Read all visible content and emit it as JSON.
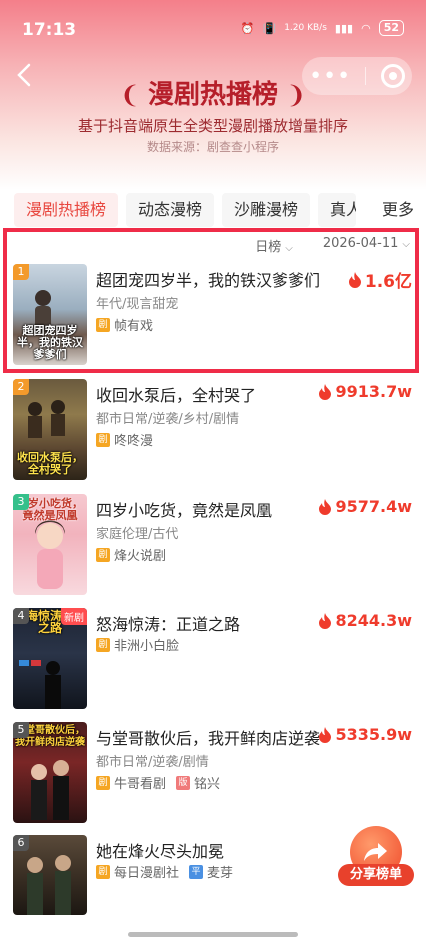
{
  "status": {
    "time": "17:13",
    "network": "1.20 KB/s",
    "signal": "5G",
    "battery": "52"
  },
  "header": {
    "title": "漫剧热播榜",
    "subtitle": "基于抖音端原生全类型漫剧播放增量排序",
    "source": "数据来源：剧查查小程序"
  },
  "tabs": [
    {
      "label": "漫剧热播榜",
      "active": true
    },
    {
      "label": "动态漫榜"
    },
    {
      "label": "沙雕漫榜"
    },
    {
      "label": "真人"
    }
  ],
  "more_label": "更多",
  "filter": {
    "period": "日榜",
    "date": "2026-04-11"
  },
  "items": [
    {
      "rank": "1",
      "rank_color": "#f39a2b",
      "title": "超团宠四岁半，我的铁汉爹爹们",
      "genre": "年代/现言甜宠",
      "tag1": "帧有戏",
      "heat": "1.6亿",
      "poster_text": "超团宠四岁半，我的铁汉爹爹们"
    },
    {
      "rank": "2",
      "rank_color": "#f39a2b",
      "title": "收回水泵后，全村哭了",
      "genre": "都市日常/逆袭/乡村/剧情",
      "tag1": "咚咚漫",
      "heat": "9913.7w",
      "poster_text": "收回水泵后，全村哭了"
    },
    {
      "rank": "3",
      "rank_color": "#35c08b",
      "title": "四岁小吃货，竟然是凤凰",
      "genre": "家庭伦理/古代",
      "tag1": "烽火说剧",
      "heat": "9577.4w",
      "poster_text": "四岁小吃货，竟然是凤凰"
    },
    {
      "rank": "4",
      "rank_color": "#555555",
      "title": "怒海惊涛：正道之路",
      "genre": "",
      "tag1": "非洲小白脸",
      "heat": "8244.3w",
      "poster_text": "怒海惊涛正道之路",
      "new_tag": "新剧"
    },
    {
      "rank": "5",
      "rank_color": "#555555",
      "title": "与堂哥散伙后，我开鲜肉店逆袭",
      "genre": "都市日常/逆袭/剧情",
      "tag1": "牛哥看剧",
      "tag2": "铭兴",
      "heat": "5335.9w",
      "poster_text": "与堂哥散伙后，我开鲜肉店逆袭"
    },
    {
      "rank": "6",
      "rank_color": "#555555",
      "title": "她在烽火尽头加冕",
      "genre": "",
      "tag1": "每日漫剧社",
      "tag2": "麦芽",
      "heat": "",
      "poster_text": ""
    }
  ],
  "badges": {
    "ju": "剧",
    "ban": "版",
    "ping": "平"
  },
  "share_label": "分享榜单",
  "colors": {
    "accent": "#e8473f",
    "title_red": "#b61f2a",
    "heat": "#ef3b2c",
    "highlight": "#ef2c48"
  }
}
